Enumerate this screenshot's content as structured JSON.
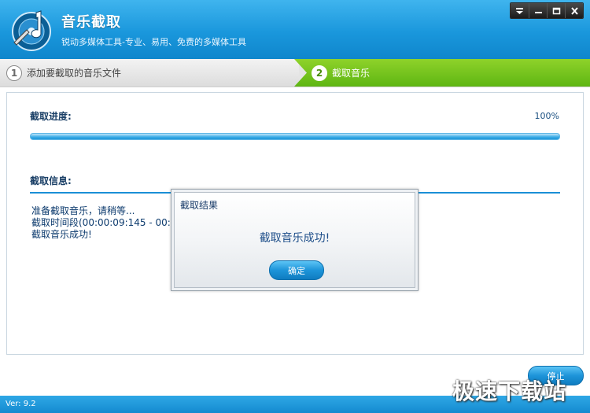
{
  "app": {
    "title": "音乐截取",
    "subtitle": "锐动多媒体工具-专业、易用、免费的多媒体工具",
    "version": "Ver: 9.2"
  },
  "window_controls": [
    "menu-icon",
    "minimize-icon",
    "maximize-icon",
    "close-icon"
  ],
  "steps": [
    {
      "number": "1",
      "label": "添加要截取的音乐文件",
      "active": false
    },
    {
      "number": "2",
      "label": "截取音乐",
      "active": true
    }
  ],
  "progress": {
    "label": "截取进度:",
    "percent_text": "100%",
    "value": 1.0
  },
  "info": {
    "label": "截取信息:",
    "lines": [
      "准备截取音乐，请稍等...",
      "截取时间段(00:00:09:145 - 00:00:1",
      "截取音乐成功!"
    ]
  },
  "dialog": {
    "title": "截取结果",
    "message": "截取音乐成功!",
    "ok_label": "确定"
  },
  "stop_button": {
    "label": "停止"
  },
  "watermark": "极速下载站",
  "colors": {
    "header_blue": "#1a97dc",
    "step_active_green": "#5eb613",
    "text_dark_blue": "#1a3f66",
    "button_blue": "#1d94d9"
  }
}
